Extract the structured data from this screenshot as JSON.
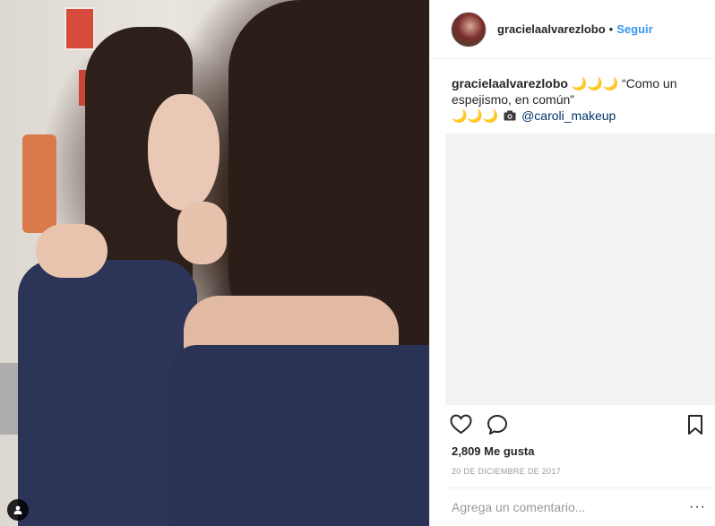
{
  "post": {
    "username": "gracielaalvarezlobo",
    "follow_label": "Seguir",
    "separator": "•"
  },
  "caption": {
    "username": "gracielaalvarezlobo",
    "line1": " 🌙🌙🌙 “Como un espejismo, en común”",
    "line2_prefix": "🌙🌙🌙",
    "camera_icon": "camera-icon",
    "mention": "@caroli_makeup"
  },
  "actions": {
    "like_icon": "heart-icon",
    "comment_icon": "comment-icon",
    "save_icon": "bookmark-icon"
  },
  "likes_text": "2,809 Me gusta",
  "date_text": "20 DE DICIEMBRE DE 2017",
  "comment_input": {
    "placeholder": "Agrega un comentario...",
    "more_label": "···"
  },
  "photo": {
    "user_tag_icon": "user-tag-icon"
  },
  "colors": {
    "link": "#3897f0",
    "mention": "#003569",
    "text": "#262626",
    "muted": "#999999"
  }
}
